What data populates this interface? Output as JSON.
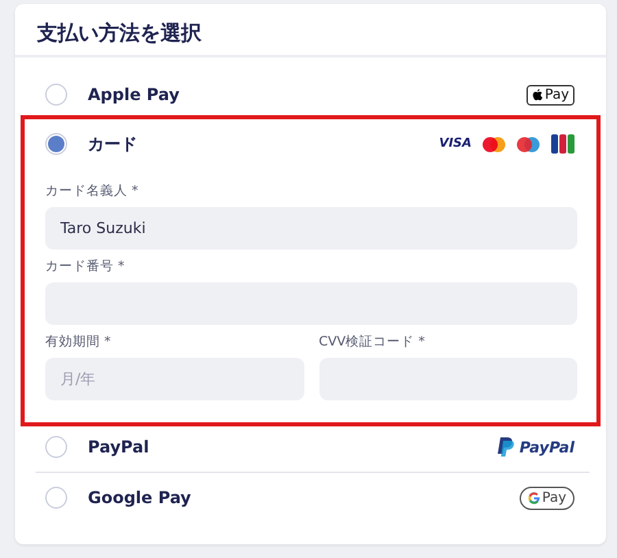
{
  "title": "支払い方法を選択",
  "methods": [
    {
      "name": "Apple Pay",
      "selected": false,
      "highlighted": false,
      "logo": {
        "kind": "apple",
        "text": "Pay"
      }
    },
    {
      "name": "カード",
      "selected": true,
      "highlighted": true,
      "logo": {
        "kind": "cards",
        "text": "VISA"
      },
      "fields": [
        {
          "label": "カード名義人 *",
          "value": "Taro Suzuki",
          "half": false
        },
        {
          "label": "カード番号 *",
          "half": false
        },
        {
          "label": "有効期間 *",
          "placeholder": "月/年",
          "half": true
        },
        {
          "label": "CVV検証コード *",
          "half": true
        }
      ]
    },
    {
      "name": "PayPal",
      "selected": false,
      "highlighted": false,
      "logo": {
        "kind": "paypal",
        "text": "PayPal"
      }
    },
    {
      "name": "Google Pay",
      "selected": false,
      "highlighted": false,
      "logo": {
        "kind": "gpay",
        "text": "Pay"
      }
    }
  ]
}
